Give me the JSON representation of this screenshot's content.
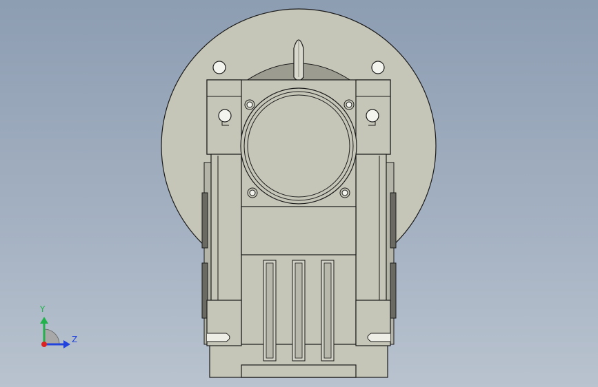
{
  "viewport": {
    "background_top": "#8d9db2",
    "background_bottom": "#b9c3cf"
  },
  "model": {
    "body_color": "#c6c6b8",
    "edge_color": "#1a1a1a",
    "shadow_color": "#8e8e84",
    "parts": [
      "flange-disc",
      "shaft-key",
      "gearbox-housing",
      "input-bore",
      "mounting-holes",
      "cooling-fins",
      "side-bosses"
    ]
  },
  "triad": {
    "y_label": "Y",
    "z_label": "Z",
    "y_color": "#22b14c",
    "z_color": "#2244dd",
    "x_color": "#dd2222"
  }
}
